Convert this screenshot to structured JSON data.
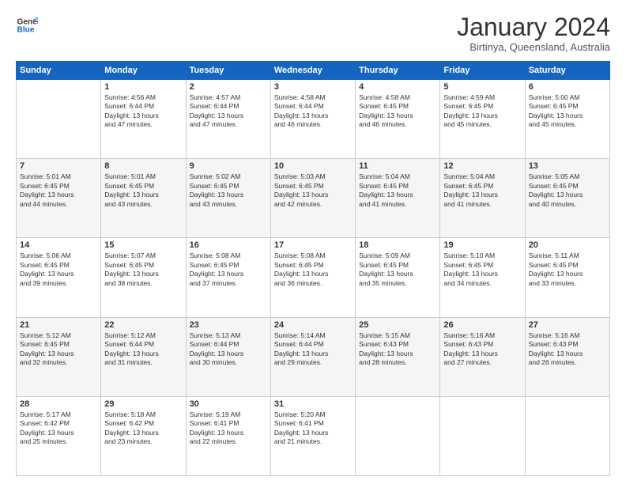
{
  "logo": {
    "line1": "General",
    "line2": "Blue"
  },
  "title": "January 2024",
  "location": "Birtinya, Queensland, Australia",
  "days_of_week": [
    "Sunday",
    "Monday",
    "Tuesday",
    "Wednesday",
    "Thursday",
    "Friday",
    "Saturday"
  ],
  "weeks": [
    [
      {
        "num": "",
        "info": ""
      },
      {
        "num": "1",
        "info": "Sunrise: 4:56 AM\nSunset: 6:44 PM\nDaylight: 13 hours\nand 47 minutes."
      },
      {
        "num": "2",
        "info": "Sunrise: 4:57 AM\nSunset: 6:44 PM\nDaylight: 13 hours\nand 47 minutes."
      },
      {
        "num": "3",
        "info": "Sunrise: 4:58 AM\nSunset: 6:44 PM\nDaylight: 13 hours\nand 46 minutes."
      },
      {
        "num": "4",
        "info": "Sunrise: 4:58 AM\nSunset: 6:45 PM\nDaylight: 13 hours\nand 46 minutes."
      },
      {
        "num": "5",
        "info": "Sunrise: 4:59 AM\nSunset: 6:45 PM\nDaylight: 13 hours\nand 45 minutes."
      },
      {
        "num": "6",
        "info": "Sunrise: 5:00 AM\nSunset: 6:45 PM\nDaylight: 13 hours\nand 45 minutes."
      }
    ],
    [
      {
        "num": "7",
        "info": "Sunrise: 5:01 AM\nSunset: 6:45 PM\nDaylight: 13 hours\nand 44 minutes."
      },
      {
        "num": "8",
        "info": "Sunrise: 5:01 AM\nSunset: 6:45 PM\nDaylight: 13 hours\nand 43 minutes."
      },
      {
        "num": "9",
        "info": "Sunrise: 5:02 AM\nSunset: 6:45 PM\nDaylight: 13 hours\nand 43 minutes."
      },
      {
        "num": "10",
        "info": "Sunrise: 5:03 AM\nSunset: 6:45 PM\nDaylight: 13 hours\nand 42 minutes."
      },
      {
        "num": "11",
        "info": "Sunrise: 5:04 AM\nSunset: 6:45 PM\nDaylight: 13 hours\nand 41 minutes."
      },
      {
        "num": "12",
        "info": "Sunrise: 5:04 AM\nSunset: 6:45 PM\nDaylight: 13 hours\nand 41 minutes."
      },
      {
        "num": "13",
        "info": "Sunrise: 5:05 AM\nSunset: 6:45 PM\nDaylight: 13 hours\nand 40 minutes."
      }
    ],
    [
      {
        "num": "14",
        "info": "Sunrise: 5:06 AM\nSunset: 6:45 PM\nDaylight: 13 hours\nand 39 minutes."
      },
      {
        "num": "15",
        "info": "Sunrise: 5:07 AM\nSunset: 6:45 PM\nDaylight: 13 hours\nand 38 minutes."
      },
      {
        "num": "16",
        "info": "Sunrise: 5:08 AM\nSunset: 6:45 PM\nDaylight: 13 hours\nand 37 minutes."
      },
      {
        "num": "17",
        "info": "Sunrise: 5:08 AM\nSunset: 6:45 PM\nDaylight: 13 hours\nand 36 minutes."
      },
      {
        "num": "18",
        "info": "Sunrise: 5:09 AM\nSunset: 6:45 PM\nDaylight: 13 hours\nand 35 minutes."
      },
      {
        "num": "19",
        "info": "Sunrise: 5:10 AM\nSunset: 6:45 PM\nDaylight: 13 hours\nand 34 minutes."
      },
      {
        "num": "20",
        "info": "Sunrise: 5:11 AM\nSunset: 6:45 PM\nDaylight: 13 hours\nand 33 minutes."
      }
    ],
    [
      {
        "num": "21",
        "info": "Sunrise: 5:12 AM\nSunset: 6:45 PM\nDaylight: 13 hours\nand 32 minutes."
      },
      {
        "num": "22",
        "info": "Sunrise: 5:12 AM\nSunset: 6:44 PM\nDaylight: 13 hours\nand 31 minutes."
      },
      {
        "num": "23",
        "info": "Sunrise: 5:13 AM\nSunset: 6:44 PM\nDaylight: 13 hours\nand 30 minutes."
      },
      {
        "num": "24",
        "info": "Sunrise: 5:14 AM\nSunset: 6:44 PM\nDaylight: 13 hours\nand 29 minutes."
      },
      {
        "num": "25",
        "info": "Sunrise: 5:15 AM\nSunset: 6:43 PM\nDaylight: 13 hours\nand 28 minutes."
      },
      {
        "num": "26",
        "info": "Sunrise: 5:16 AM\nSunset: 6:43 PM\nDaylight: 13 hours\nand 27 minutes."
      },
      {
        "num": "27",
        "info": "Sunrise: 5:16 AM\nSunset: 6:43 PM\nDaylight: 13 hours\nand 26 minutes."
      }
    ],
    [
      {
        "num": "28",
        "info": "Sunrise: 5:17 AM\nSunset: 6:42 PM\nDaylight: 13 hours\nand 25 minutes."
      },
      {
        "num": "29",
        "info": "Sunrise: 5:18 AM\nSunset: 6:42 PM\nDaylight: 13 hours\nand 23 minutes."
      },
      {
        "num": "30",
        "info": "Sunrise: 5:19 AM\nSunset: 6:41 PM\nDaylight: 13 hours\nand 22 minutes."
      },
      {
        "num": "31",
        "info": "Sunrise: 5:20 AM\nSunset: 6:41 PM\nDaylight: 13 hours\nand 21 minutes."
      },
      {
        "num": "",
        "info": ""
      },
      {
        "num": "",
        "info": ""
      },
      {
        "num": "",
        "info": ""
      }
    ]
  ]
}
